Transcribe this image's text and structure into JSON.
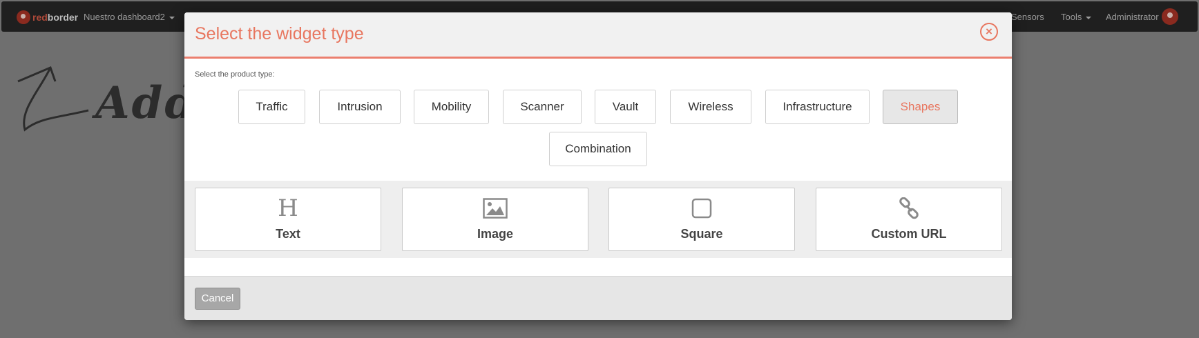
{
  "navbar": {
    "brand_red": "red",
    "brand_white": "border",
    "dashboard_label": "Nuestro dashboard2",
    "sensors_label": "Sensors",
    "tools_label": "Tools",
    "admin_label": "Administrator"
  },
  "background": {
    "sketch_text": "Add"
  },
  "modal": {
    "title": "Select the widget type",
    "close_label": "×",
    "product_label": "Select the product type:",
    "product_types": [
      "Traffic",
      "Intrusion",
      "Mobility",
      "Scanner",
      "Vault",
      "Wireless",
      "Infrastructure",
      "Shapes",
      "Combination"
    ],
    "active_product_type": "Shapes",
    "widgets": [
      {
        "label": "Text",
        "icon": "heading-icon"
      },
      {
        "label": "Image",
        "icon": "image-icon"
      },
      {
        "label": "Square",
        "icon": "square-icon"
      },
      {
        "label": "Custom URL",
        "icon": "link-icon"
      }
    ],
    "cancel_label": "Cancel"
  },
  "colors": {
    "accent": "#e8765f",
    "overlay": "#6f6f6f",
    "navbar": "#1f1f1f"
  }
}
